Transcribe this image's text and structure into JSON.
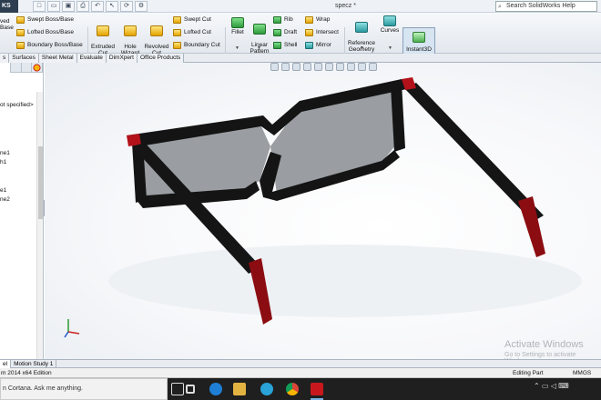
{
  "titlebar": {
    "brand_text": "KS",
    "document_title": "specz *",
    "search_placeholder": "Search SolidWorks Help",
    "quick_access": [
      "new-icon",
      "open-icon",
      "save-icon",
      "print-icon",
      "undo-icon",
      "select-icon",
      "rebuild-icon",
      "options-icon"
    ]
  },
  "ribbon": {
    "left_partial_labels": [
      "ved",
      "Base"
    ],
    "boss_group": [
      "Swept Boss/Base",
      "Lofted Boss/Base",
      "Boundary Boss/Base"
    ],
    "extruded_cut": "Extruded\nCut",
    "hole_wizard": "Hole\nWizard",
    "revolved_cut": "Revolved\nCut",
    "cut_group": [
      "Swept Cut",
      "Lofted Cut",
      "Boundary Cut"
    ],
    "fillet": "Fillet",
    "linear_pattern": "Linear\nPattern",
    "feature_group_a": [
      "Rib",
      "Draft",
      "Shell"
    ],
    "feature_group_b": [
      "Wrap",
      "Intersect",
      "Mirror"
    ],
    "reference_geometry": "Reference\nGeometry",
    "curves": "Curves",
    "instant3d": "Instant3D"
  },
  "tabs": [
    "s",
    "Surfaces",
    "Sheet Metal",
    "Evaluate",
    "DimXpert",
    "Office Products"
  ],
  "tree": {
    "items": [
      "ot specified>",
      "ne1",
      "h1",
      "e1",
      "ne2"
    ]
  },
  "viewport": {
    "watermark_title": "Activate Windows",
    "watermark_sub": "Go to Settings to activate Windows."
  },
  "bottom_tabs": [
    "el",
    "Motion Study 1"
  ],
  "status": {
    "edition": "m 2014 x64 Edition",
    "mode": "Editing Part",
    "units": "MMGS"
  },
  "taskbar": {
    "cortana_text": "n Cortana. Ask me anything.",
    "apps": [
      "windows-start-icon",
      "task-view-icon",
      "edge-icon",
      "file-explorer-icon",
      "edge-beta-icon",
      "chrome-icon",
      "solidworks-icon"
    ]
  },
  "colors": {
    "frame": "#111111",
    "accent_red": "#b3121a",
    "lens": "#8f9398",
    "ribbon_bg": "#eaeef3"
  }
}
